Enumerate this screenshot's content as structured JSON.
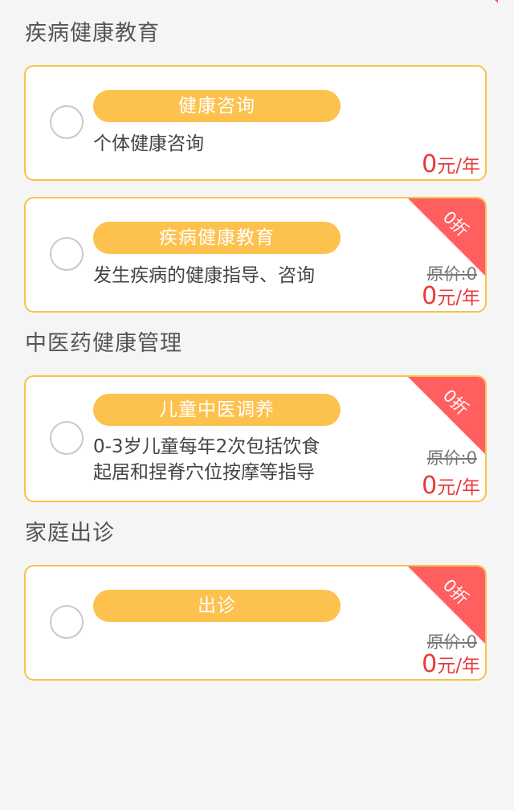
{
  "sections": [
    {
      "title": "疾病健康教育",
      "cards": [
        {
          "pill": "健康咨询",
          "desc_lines": [
            "个体健康咨询"
          ],
          "price_num": "0",
          "price_unit": "元/年",
          "discount": null,
          "original_price": null
        },
        {
          "pill": "疾病健康教育",
          "desc_lines": [
            "发生疾病的健康指导、咨询"
          ],
          "price_num": "0",
          "price_unit": "元/年",
          "discount": "0折",
          "original_price": "原价:0"
        }
      ]
    },
    {
      "title": "中医药健康管理",
      "cards": [
        {
          "pill": "儿童中医调养",
          "desc_lines": [
            "0-3岁儿童每年2次包括饮食",
            "起居和捏脊穴位按摩等指导"
          ],
          "price_num": "0",
          "price_unit": "元/年",
          "discount": "0折",
          "original_price": "原价:0"
        }
      ]
    },
    {
      "title": "家庭出诊",
      "cards": [
        {
          "pill": "出诊",
          "desc_lines": [],
          "price_num": "0",
          "price_unit": "元/年",
          "discount": "0折",
          "original_price": "原价:0"
        }
      ]
    }
  ],
  "colors": {
    "accent": "#fdc14d",
    "border": "#f7c34a",
    "price": "#ea3a3a",
    "ribbon": "#ff5f5f"
  }
}
